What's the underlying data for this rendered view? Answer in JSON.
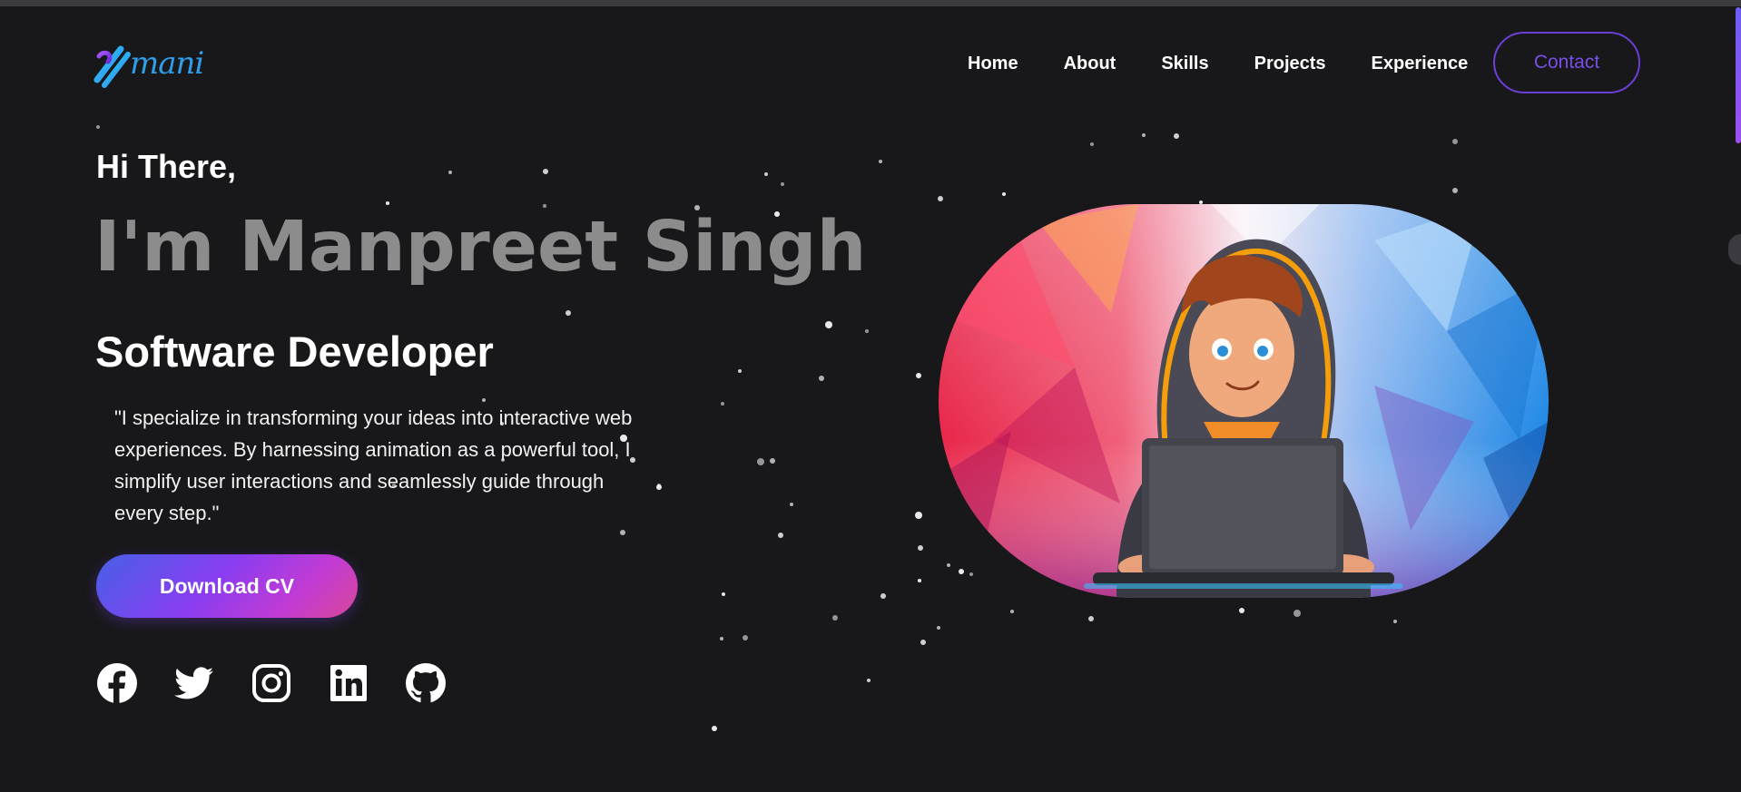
{
  "header": {
    "logo_text": "mani",
    "nav": [
      "Home",
      "About",
      "Skills",
      "Projects",
      "Experience"
    ],
    "contact_label": "Contact"
  },
  "hero": {
    "greeting": "Hi There,",
    "name": "I'm Manpreet Singh",
    "role": "Software Developer",
    "quote": "\"I specialize in transforming your ideas into interactive web experiences. By harnessing animation as a powerful tool, I simplify user interactions and seamlessly guide through every step.\"",
    "cta_label": "Download CV"
  },
  "socials": [
    {
      "icon": "facebook-icon"
    },
    {
      "icon": "twitter-icon"
    },
    {
      "icon": "instagram-icon"
    },
    {
      "icon": "linkedin-icon"
    },
    {
      "icon": "github-icon"
    }
  ],
  "illustration": {
    "icon": "developer-avatar-illustration"
  },
  "colors": {
    "background": "#18181b",
    "accent_purple": "#6a3fd6",
    "name_gray": "#8c8c8c",
    "logo_blue": "#2f9ee8"
  }
}
